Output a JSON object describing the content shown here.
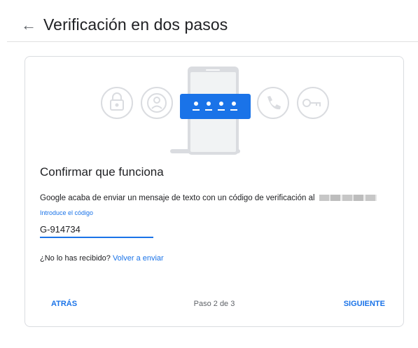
{
  "header": {
    "title": "Verificación en dos pasos"
  },
  "card": {
    "illustration": {
      "icons": [
        "lock-icon",
        "account-icon",
        "phone-sms-code-icon",
        "call-icon",
        "key-icon"
      ],
      "accent_color": "#1a73e8"
    },
    "section_title": "Confirmar que funciona",
    "description": "Google acaba de enviar un mensaje de texto con un código de verificación al",
    "input": {
      "label": "Introduce el código",
      "value": "G-914734"
    },
    "resend": {
      "prompt": "¿No lo has recibido?",
      "link": "Volver a enviar"
    },
    "footer": {
      "back_label": "ATRÁS",
      "step_text": "Paso 2 de 3",
      "next_label": "SIGUIENTE"
    }
  }
}
